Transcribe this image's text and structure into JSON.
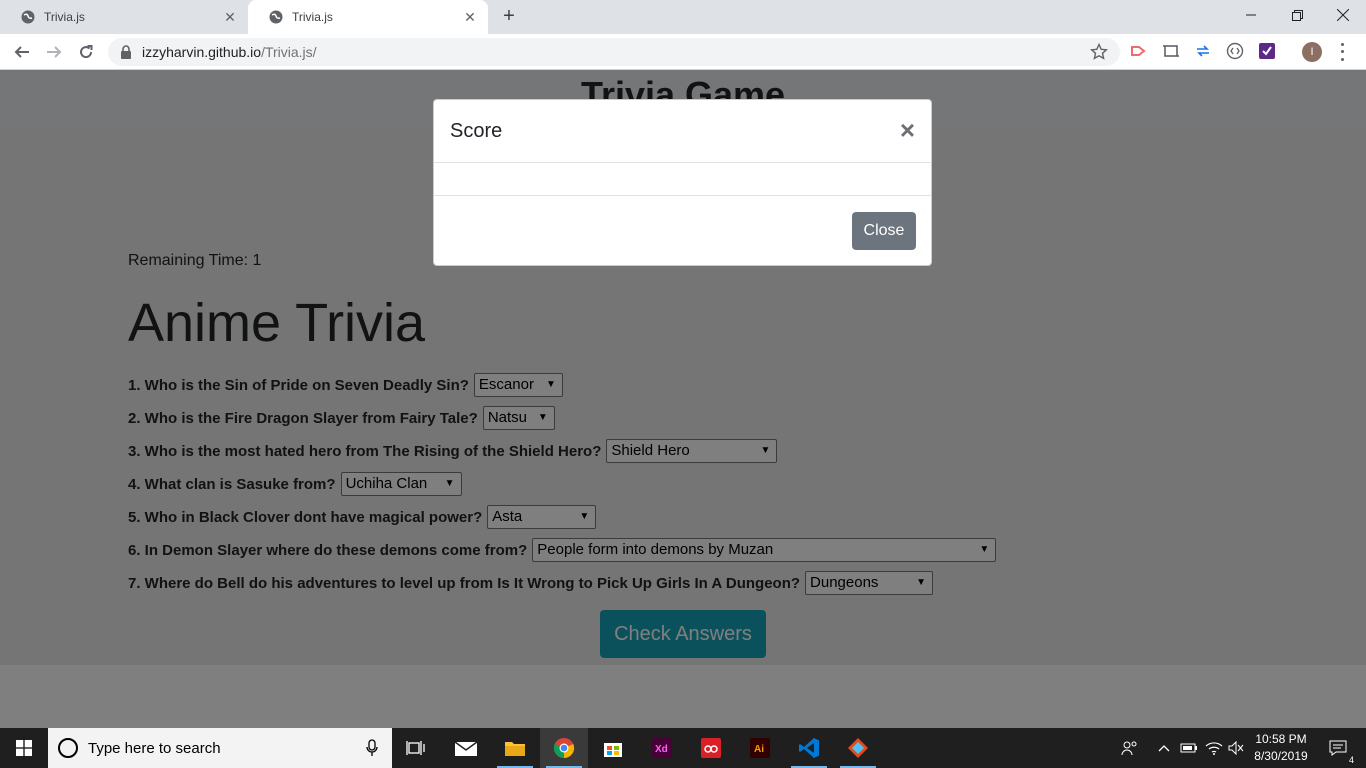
{
  "browser": {
    "tabs": [
      {
        "title": "Trivia.js",
        "active": false
      },
      {
        "title": "Trivia.js",
        "active": true
      }
    ],
    "url_host": "izzyharvin.github.io",
    "url_path": "/Trivia.js/",
    "profile_initial": "I"
  },
  "page": {
    "header_title": "Trivia Game",
    "timer_label": "Remaining Time: 1",
    "trivia_title": "Anime Trivia",
    "questions": [
      {
        "text": "1. Who is the Sin of Pride on Seven Deadly Sin?",
        "answer": "Escanor"
      },
      {
        "text": "2. Who is the Fire Dragon Slayer from Fairy Tale?",
        "answer": "Natsu"
      },
      {
        "text": "3. Who is the most hated hero from The Rising of the Shield Hero?",
        "answer": "Shield Hero"
      },
      {
        "text": "4. What clan is Sasuke from?",
        "answer": "Uchiha Clan"
      },
      {
        "text": "5. Who in Black Clover dont have magical power?",
        "answer": "Asta"
      },
      {
        "text": "6. In Demon Slayer where do these demons come from?",
        "answer": "People form into demons by Muzan"
      },
      {
        "text": "7. Where do Bell do his adventures to level up from Is It Wrong to Pick Up Girls In A Dungeon?",
        "answer": "Dungeons"
      }
    ],
    "check_button": "Check Answers"
  },
  "modal": {
    "title": "Score",
    "close_x": "×",
    "close_button": "Close"
  },
  "taskbar": {
    "search_placeholder": "Type here to search",
    "time": "10:58 PM",
    "date": "8/30/2019",
    "notification_count": "4"
  },
  "colors": {
    "accent_teal": "#17a2b8",
    "modal_close_gray": "#6c757d"
  }
}
